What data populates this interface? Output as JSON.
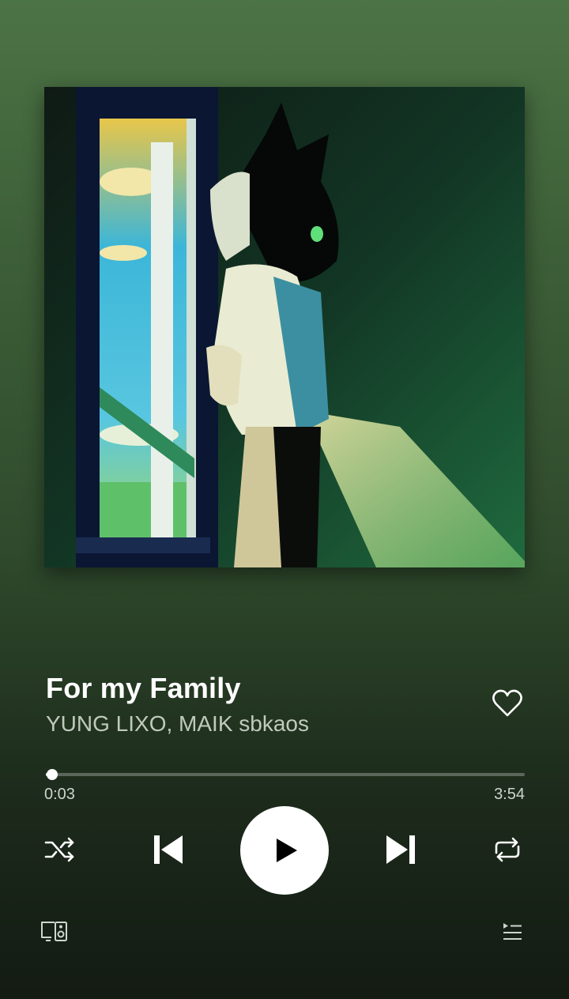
{
  "track": {
    "title": "For my Family",
    "artists": "YUNG LIXO, MAIK sbkaos",
    "liked": false
  },
  "playback": {
    "elapsed": "0:03",
    "duration": "3:54",
    "progress_fraction": 0.013,
    "state": "paused"
  },
  "controls": {
    "shuffle_icon": "shuffle-icon",
    "previous_icon": "skip-previous-icon",
    "play_icon": "play-icon",
    "next_icon": "skip-next-icon",
    "repeat_icon": "repeat-icon",
    "devices_icon": "connect-devices-icon",
    "queue_icon": "queue-icon"
  },
  "colors": {
    "background_top": "#4c7345",
    "background_bottom": "#131b13",
    "accent": "#ffffff",
    "secondary_text": "#bfcabd"
  }
}
